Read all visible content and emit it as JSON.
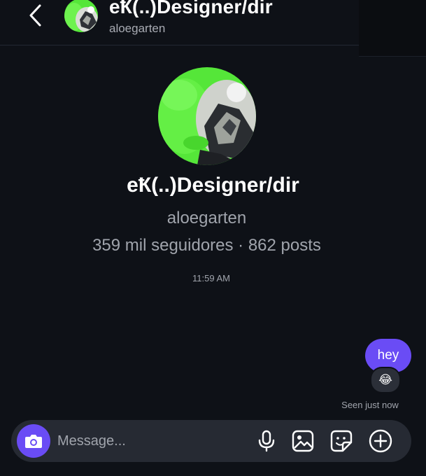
{
  "header": {
    "back_icon": "chevron-left-icon",
    "name": "eҞ(..)Designer/dir",
    "username": "aloegarten"
  },
  "profile": {
    "name": "eҞ(..)Designer/dir",
    "username": "aloegarten",
    "stats": "359 mil seguidores · 862 posts"
  },
  "thread": {
    "timestamp": "11:59 AM",
    "messages": [
      {
        "from": "me",
        "text": "hey",
        "reaction": "😂"
      }
    ],
    "seen": "Seen just now"
  },
  "composer": {
    "placeholder": "Message...",
    "icons": [
      "camera-icon",
      "microphone-icon",
      "gallery-icon",
      "sticker-icon",
      "plus-circle-icon"
    ]
  },
  "colors": {
    "background": "#0e1117",
    "accent": "#6a4cf5",
    "bubble_me": "#6a4cf5",
    "composer": "#262a33",
    "muted_text": "#a0a4ac",
    "avatar_green": "#55e639"
  }
}
